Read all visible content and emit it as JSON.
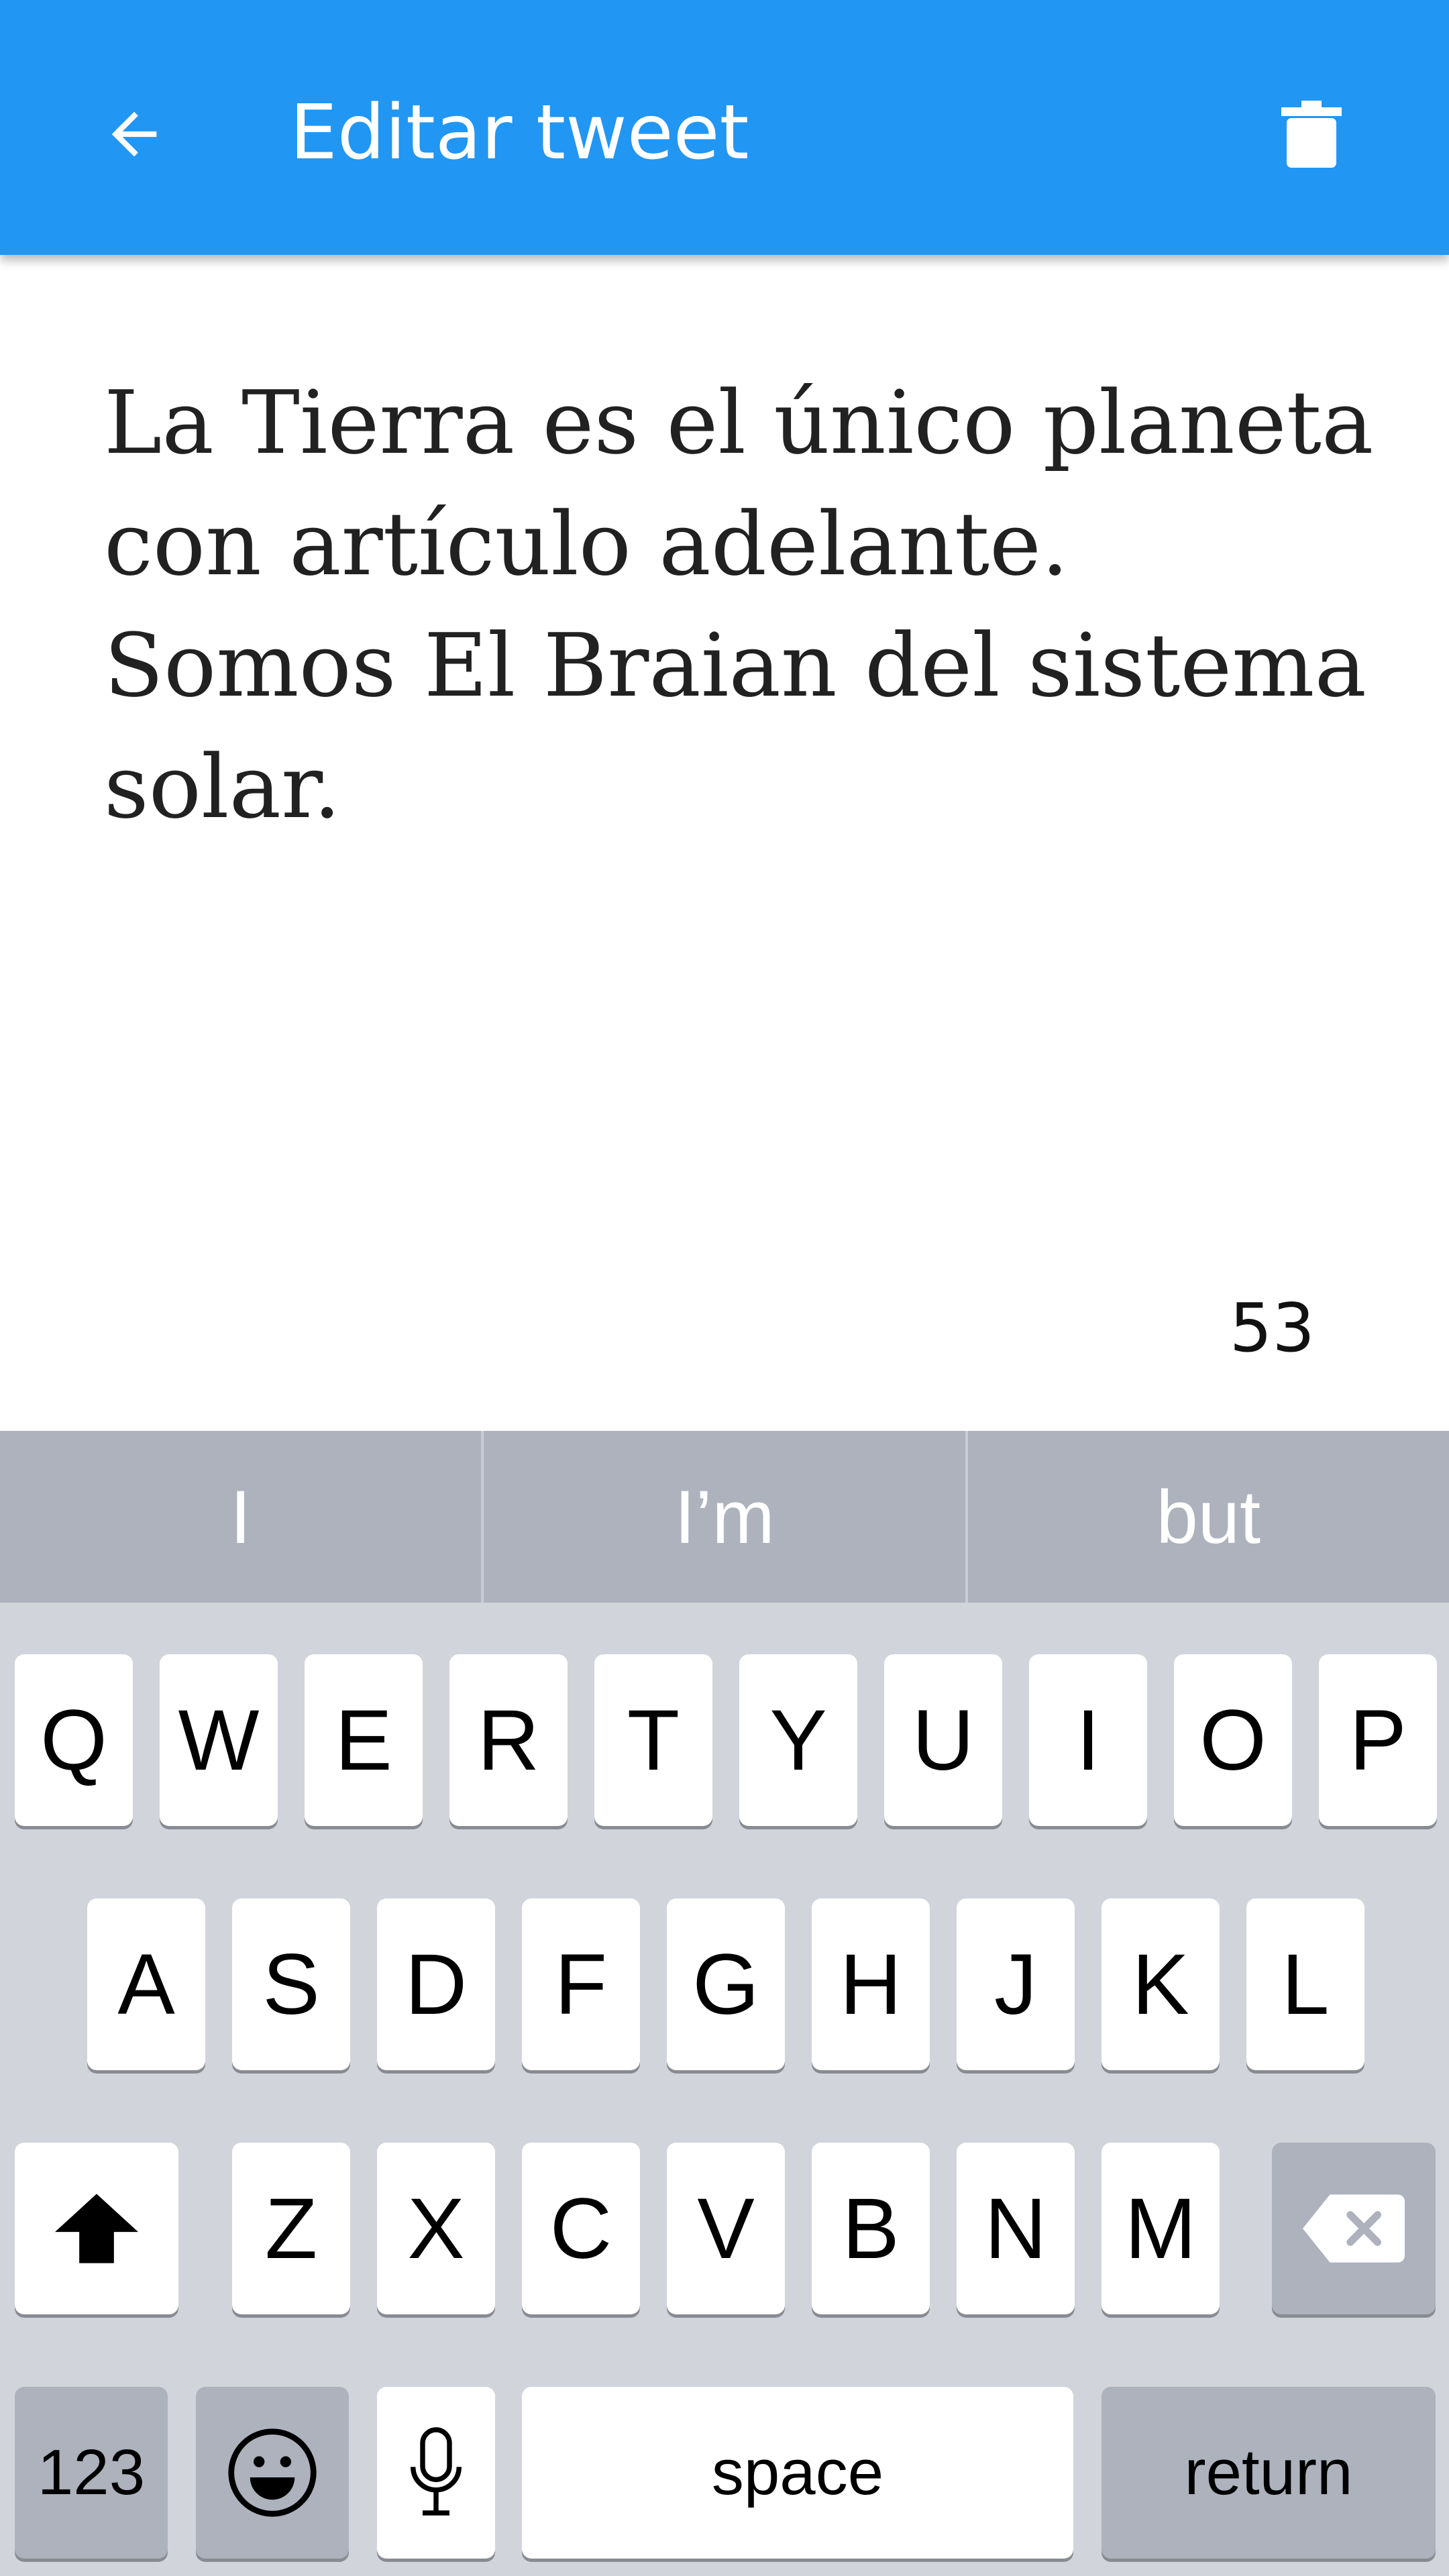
{
  "header": {
    "title": "Editar tweet",
    "back_icon": "arrow-back-icon",
    "delete_icon": "trash-icon",
    "color": "#2196F3"
  },
  "tweet": {
    "text": "La Tierra es el único planeta con artículo adelante. Somos El Braian del sistema solar.",
    "char_count": "53"
  },
  "keyboard": {
    "suggestions": [
      "I",
      "I’m",
      "but"
    ],
    "row1": [
      "Q",
      "W",
      "E",
      "R",
      "T",
      "Y",
      "U",
      "I",
      "O",
      "P"
    ],
    "row2": [
      "A",
      "S",
      "D",
      "F",
      "G",
      "H",
      "J",
      "K",
      "L"
    ],
    "row3": [
      "Z",
      "X",
      "C",
      "V",
      "B",
      "N",
      "M"
    ],
    "shift_icon": "shift-icon",
    "backspace_icon": "backspace-icon",
    "numbers_label": "123",
    "emoji_icon": "emoji-icon",
    "mic_icon": "microphone-icon",
    "space_label": "space",
    "return_label": "return"
  }
}
